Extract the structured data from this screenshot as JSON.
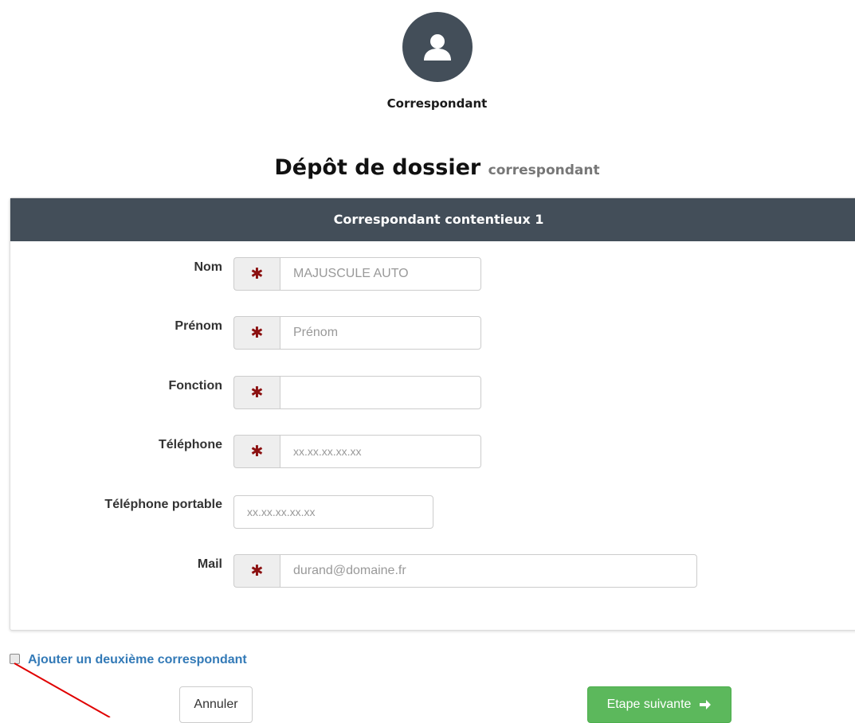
{
  "step": {
    "label": "Correspondant",
    "icon": "user-icon"
  },
  "page": {
    "title": "Dépôt de dossier",
    "subtitle": "correspondant"
  },
  "panel": {
    "title": "Correspondant contentieux 1"
  },
  "fields": {
    "nom": {
      "label": "Nom",
      "placeholder": "MAJUSCULE AUTO",
      "required": true
    },
    "prenom": {
      "label": "Prénom",
      "placeholder": "Prénom",
      "required": true
    },
    "fonction": {
      "label": "Fonction",
      "placeholder": "",
      "required": true
    },
    "telephone": {
      "label": "Téléphone",
      "placeholder": "xx.xx.xx.xx.xx",
      "required": true
    },
    "portable": {
      "label": "Téléphone portable",
      "placeholder": "xx.xx.xx.xx.xx",
      "required": false
    },
    "mail": {
      "label": "Mail",
      "placeholder": "durand@domaine.fr",
      "required": true
    }
  },
  "required_marker": "✱",
  "add_second": {
    "label": "Ajouter un deuxième correspondant",
    "checked": false
  },
  "buttons": {
    "cancel": "Annuler",
    "next": "Etape suivante",
    "next_icon": "arrow-right-icon"
  },
  "colors": {
    "header_bg": "#434e59",
    "required_marker": "#8b1010",
    "link": "#337ab7",
    "success": "#5cb85c",
    "annotation": "#e00000"
  }
}
